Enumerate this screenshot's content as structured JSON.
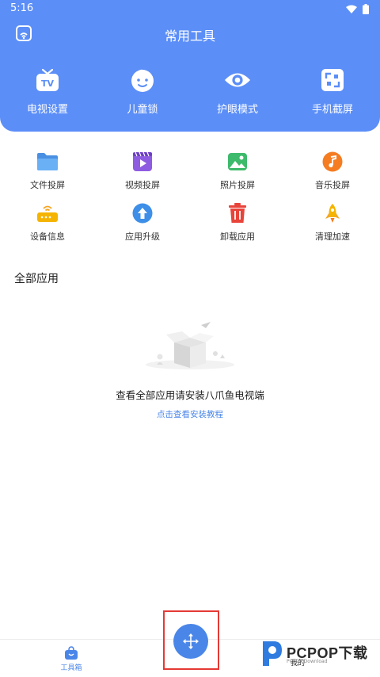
{
  "status_bar": {
    "time": "5:16"
  },
  "header": {
    "title": "常用工具",
    "tools": [
      {
        "label": "电视设置",
        "icon": "tv-icon"
      },
      {
        "label": "儿童锁",
        "icon": "child-face-icon"
      },
      {
        "label": "护眼模式",
        "icon": "eye-icon"
      },
      {
        "label": "手机截屏",
        "icon": "screenshot-icon"
      }
    ]
  },
  "grid": [
    [
      {
        "label": "文件投屏",
        "icon": "folder-icon"
      },
      {
        "label": "视频投屏",
        "icon": "video-icon"
      },
      {
        "label": "照片投屏",
        "icon": "photo-icon"
      },
      {
        "label": "音乐投屏",
        "icon": "music-icon"
      }
    ],
    [
      {
        "label": "设备信息",
        "icon": "router-icon"
      },
      {
        "label": "应用升级",
        "icon": "upgrade-icon"
      },
      {
        "label": "卸载应用",
        "icon": "trash-icon"
      },
      {
        "label": "清理加速",
        "icon": "rocket-icon"
      }
    ]
  ],
  "all_apps": {
    "title": "全部应用",
    "empty_text": "查看全部应用请安装八爪鱼电视端",
    "link": "点击查看安装教程"
  },
  "bottom_nav": {
    "toolbox_label": "工具箱",
    "mine_label": "我的"
  },
  "watermark": {
    "text": "PCPOP下载",
    "sub": "PCPOP Download"
  },
  "colors": {
    "header_bg": "#5b8ef7",
    "accent": "#4a86e8",
    "highlight": "#e53935"
  }
}
